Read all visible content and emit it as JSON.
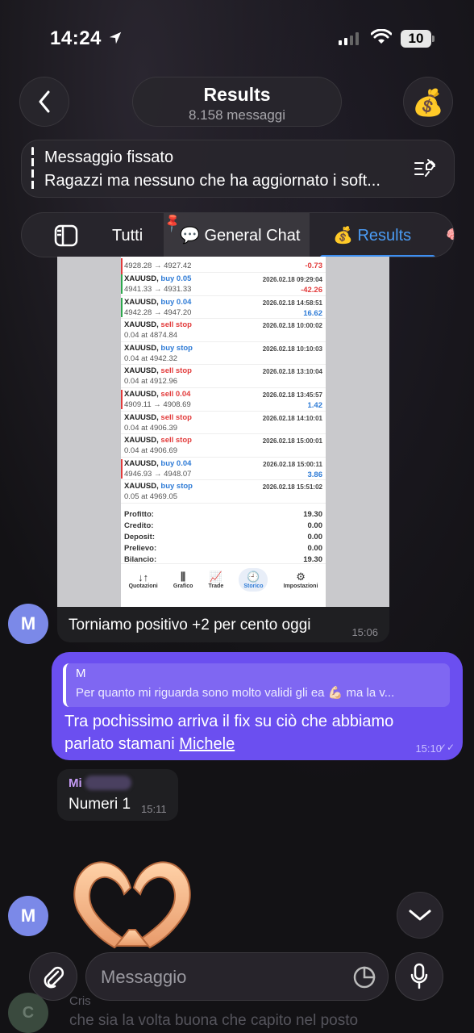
{
  "status": {
    "time": "14:24",
    "battery": "10"
  },
  "header": {
    "title": "Results",
    "subtitle": "8.158 messaggi",
    "avatar_emoji": "💰"
  },
  "pinned": {
    "label": "Messaggio fissato",
    "text": "Ragazzi ma nessuno che ha aggiornato i soft..."
  },
  "tabs": [
    {
      "label": "Tutti"
    },
    {
      "label": "💬 General Chat"
    },
    {
      "label": "💰 Results"
    },
    {
      "label": "🧠"
    }
  ],
  "trade_screenshot": {
    "rows": [
      {
        "line1": "",
        "line2": "4928.28 → 4927.42",
        "date": "",
        "profit": "-0.73",
        "side": "sell"
      },
      {
        "line1": "XAUUSD,",
        "op": "buy 0.05",
        "line2": "4941.33 → 4931.33",
        "date": "2026.02.18 09:29:04",
        "profit": "-42.26",
        "side": "buy"
      },
      {
        "line1": "XAUUSD,",
        "op": "buy 0.04",
        "line2": "4942.28 → 4947.20",
        "date": "2026.02.18 14:58:51",
        "profit": "16.62",
        "side": "buy"
      },
      {
        "line1": "XAUUSD,",
        "op": "sell stop",
        "line2": "0.04 at 4874.84",
        "date": "2026.02.18 10:00:02",
        "profit": "",
        "side": "none"
      },
      {
        "line1": "XAUUSD,",
        "op": "buy stop",
        "line2": "0.04 at 4942.32",
        "date": "2026.02.18 10:10:03",
        "profit": "",
        "side": "none"
      },
      {
        "line1": "XAUUSD,",
        "op": "sell stop",
        "line2": "0.04 at 4912.96",
        "date": "2026.02.18 13:10:04",
        "profit": "",
        "side": "none"
      },
      {
        "line1": "XAUUSD,",
        "op": "sell 0.04",
        "line2": "4909.11 → 4908.69",
        "date": "2026.02.18 13:45:57",
        "profit": "1.42",
        "side": "sell"
      },
      {
        "line1": "XAUUSD,",
        "op": "sell stop",
        "line2": "0.04 at 4906.39",
        "date": "2026.02.18 14:10:01",
        "profit": "",
        "side": "none"
      },
      {
        "line1": "XAUUSD,",
        "op": "sell stop",
        "line2": "0.04 at 4906.69",
        "date": "2026.02.18 15:00:01",
        "profit": "",
        "side": "none"
      },
      {
        "line1": "XAUUSD,",
        "op": "buy 0.04",
        "line2": "4946.93 → 4948.07",
        "date": "2026.02.18 15:00:11",
        "profit": "3.86",
        "side": "sell"
      },
      {
        "line1": "XAUUSD,",
        "op": "buy stop",
        "line2": "0.05 at 4969.05",
        "date": "2026.02.18 15:51:02",
        "profit": "",
        "side": "none"
      }
    ],
    "summary": [
      {
        "label": "Profitto:",
        "value": "19.30"
      },
      {
        "label": "Credito:",
        "value": "0.00"
      },
      {
        "label": "Deposit:",
        "value": "0.00"
      },
      {
        "label": "Prelievo:",
        "value": "0.00"
      },
      {
        "label": "Bilancio:",
        "value": "19.30"
      }
    ],
    "nav": [
      "Quotazioni",
      "Grafico",
      "Trade",
      "Storico",
      "Impostazioni"
    ]
  },
  "messages": {
    "caption": {
      "text": "Torniamo positivo +2 per cento oggi",
      "time": "15:06",
      "avatar": "M"
    },
    "outgoing": {
      "reply_name": "M",
      "reply_text": "Per quanto mi riguarda sono molto validi gli ea 💪🏻 ma la v...",
      "body": "Tra pochissimo arriva il fix su ciò che abbiamo parlato stamani ",
      "link": "Michele",
      "time": "15:10"
    },
    "incoming": {
      "name": "Mi",
      "text": "Numeri 1",
      "time": "15:11"
    },
    "sticker_avatar": "M"
  },
  "background_preview": {
    "name": "Cris",
    "text": "che sia la volta buona che capito nel posto",
    "avatar": "C"
  },
  "composer": {
    "placeholder": "Messaggio"
  }
}
